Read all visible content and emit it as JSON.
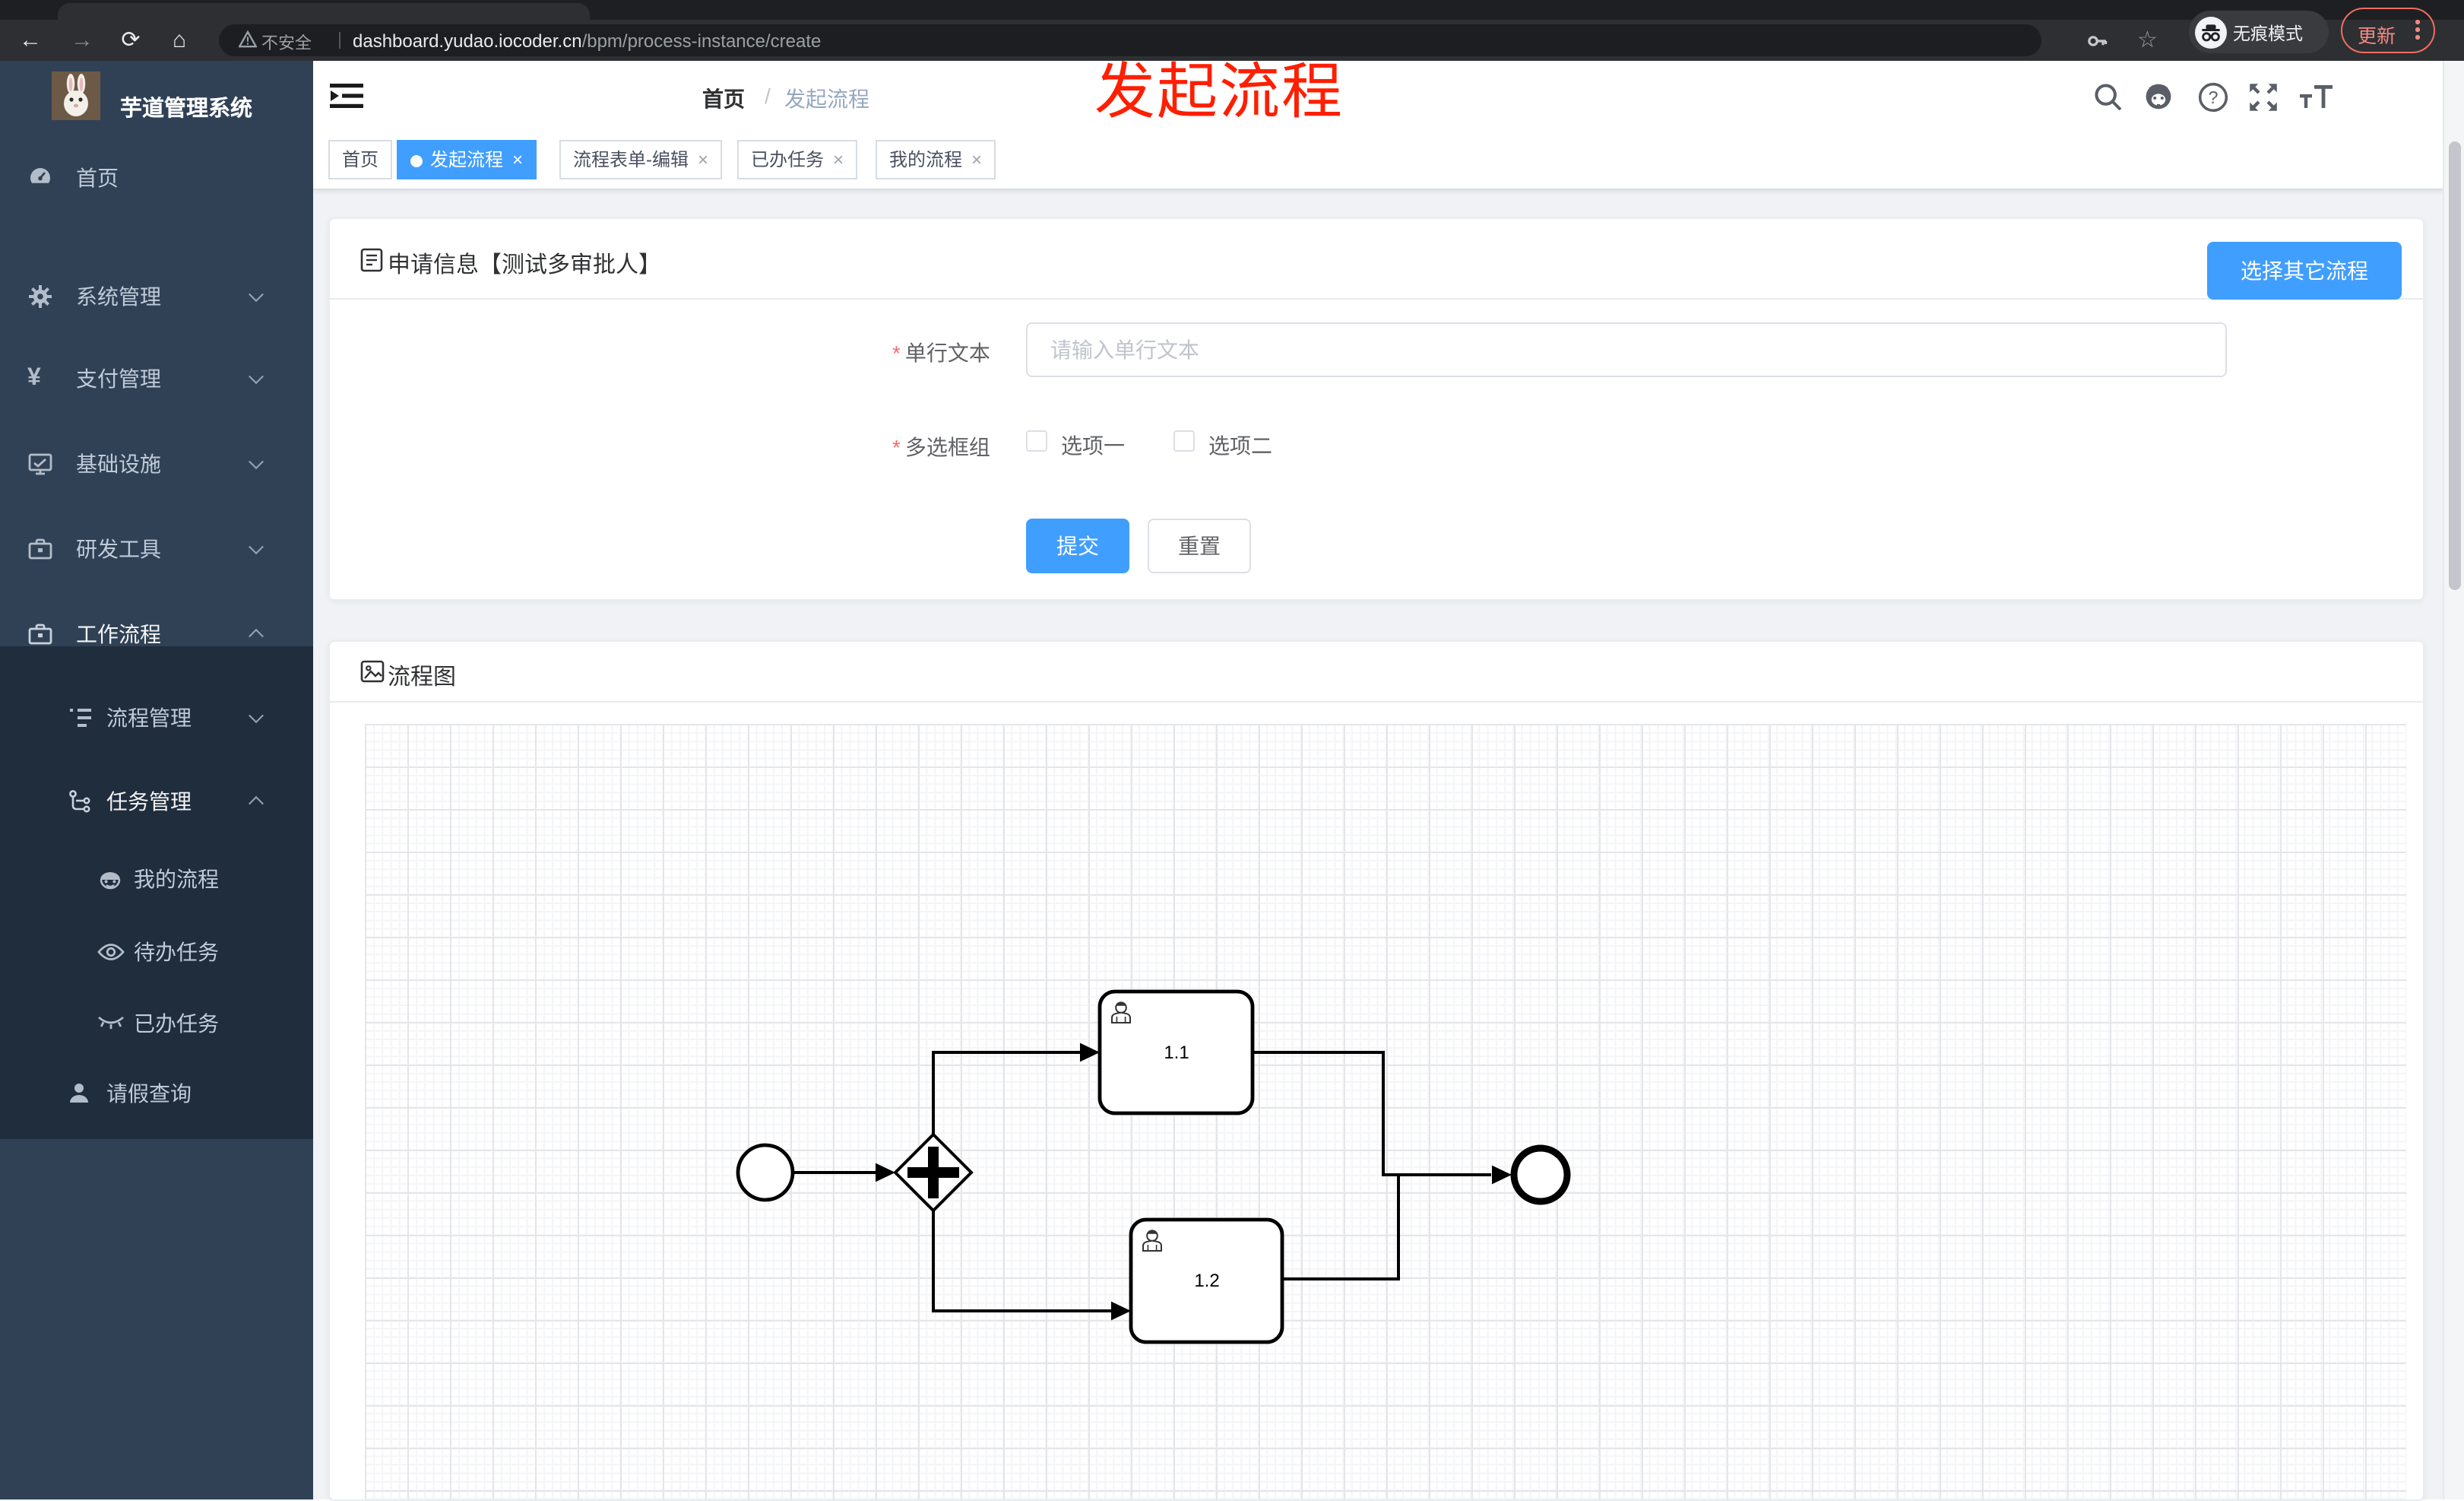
{
  "browser": {
    "security_label": "不安全",
    "url_host": "dashboard.yudao.iocoder.cn",
    "url_path": "/bpm/process-instance/create",
    "incognito_label": "无痕模式",
    "update_label": "更新"
  },
  "icons": {
    "back": "←",
    "forward": "→",
    "reload": "⟳",
    "home": "⌂",
    "star": "☆",
    "close": "×",
    "breadcrumb_separator": "/",
    "required_mark": "*",
    "yen": "¥",
    "question": "?"
  },
  "sidebar": {
    "title": "芋道管理系统",
    "items": [
      {
        "label": "首页"
      },
      {
        "label": "系统管理"
      },
      {
        "label": "支付管理"
      },
      {
        "label": "基础设施"
      },
      {
        "label": "研发工具"
      },
      {
        "label": "工作流程"
      },
      {
        "label": "流程管理"
      },
      {
        "label": "任务管理"
      },
      {
        "label": "我的流程"
      },
      {
        "label": "待办任务"
      },
      {
        "label": "已办任务"
      },
      {
        "label": "请假查询"
      }
    ]
  },
  "header": {
    "breadcrumb": [
      "首页",
      "发起流程"
    ]
  },
  "annotation": "发起流程",
  "tabs": [
    {
      "label": "首页",
      "active": false,
      "closable": false
    },
    {
      "label": "发起流程",
      "active": true,
      "closable": true
    },
    {
      "label": "流程表单-编辑",
      "active": false,
      "closable": true
    },
    {
      "label": "已办任务",
      "active": false,
      "closable": true
    },
    {
      "label": "我的流程",
      "active": false,
      "closable": true
    }
  ],
  "form_card": {
    "title": "申请信息【测试多审批人】",
    "choose_other_button": "选择其它流程",
    "fields": [
      {
        "label": "单行文本",
        "required": true,
        "placeholder": "请输入单行文本",
        "value": ""
      },
      {
        "label": "多选框组",
        "required": true,
        "options": [
          {
            "label": "选项一",
            "checked": false
          },
          {
            "label": "选项二",
            "checked": false
          }
        ]
      }
    ],
    "submit_label": "提交",
    "reset_label": "重置"
  },
  "flow_card": {
    "title": "流程图",
    "diagram": {
      "type": "bpmn",
      "nodes": [
        {
          "id": "start",
          "type": "startEvent"
        },
        {
          "id": "gateway",
          "type": "parallelGateway"
        },
        {
          "id": "task1",
          "type": "userTask",
          "label": "1.1"
        },
        {
          "id": "task2",
          "type": "userTask",
          "label": "1.2"
        },
        {
          "id": "end",
          "type": "endEvent"
        }
      ],
      "flows": [
        [
          "start",
          "gateway"
        ],
        [
          "gateway",
          "task1"
        ],
        [
          "gateway",
          "task2"
        ],
        [
          "task1",
          "end"
        ],
        [
          "task2",
          "end"
        ]
      ]
    }
  }
}
